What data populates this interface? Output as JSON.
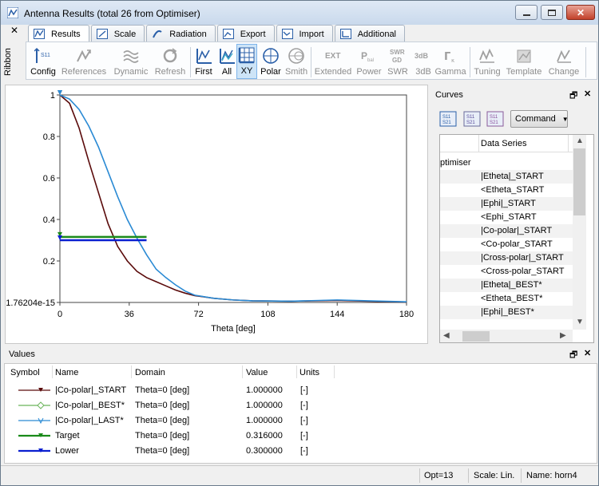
{
  "window": {
    "title": "Antenna Results (total 26 from Optimiser)"
  },
  "ribbon": {
    "side_label": "Ribbon",
    "tabs": [
      {
        "label": "Results",
        "icon": "results-tab-icon"
      },
      {
        "label": "Scale",
        "icon": "scale-tab-icon"
      },
      {
        "label": "Radiation",
        "icon": "radiation-tab-icon"
      },
      {
        "label": "Export",
        "icon": "export-tab-icon"
      },
      {
        "label": "Import",
        "icon": "import-tab-icon"
      },
      {
        "label": "Additional",
        "icon": "additional-tab-icon"
      }
    ],
    "buttons": [
      {
        "label": "Config",
        "icon_text": "S11",
        "enabled": true
      },
      {
        "label": "References",
        "enabled": false
      },
      {
        "label": "Dynamic",
        "enabled": false
      },
      {
        "label": "Refresh",
        "enabled": false
      },
      {
        "label": "First",
        "enabled": true
      },
      {
        "label": "All",
        "enabled": true
      },
      {
        "label": "XY",
        "enabled": true,
        "selected": true
      },
      {
        "label": "Polar",
        "enabled": true
      },
      {
        "label": "Smith",
        "enabled": false
      },
      {
        "label": "Extended",
        "icon_text": "EXT",
        "enabled": false
      },
      {
        "label": "Power",
        "icon_text": "Pbal",
        "enabled": false
      },
      {
        "label": "SWR",
        "icon_text": "SWR GD",
        "enabled": false
      },
      {
        "label": "3dB",
        "icon_text": "3dB",
        "enabled": false
      },
      {
        "label": "Gamma",
        "icon_text": "Γκ",
        "enabled": false
      },
      {
        "label": "Tuning",
        "enabled": false
      },
      {
        "label": "Template",
        "enabled": false
      },
      {
        "label": "Change",
        "enabled": false
      }
    ]
  },
  "chart_data": {
    "type": "line",
    "xlabel": "Theta [deg]",
    "ylabel": "",
    "xlim": [
      0,
      180
    ],
    "ylim": [
      0,
      1
    ],
    "x_ticks": [
      "0",
      "36",
      "72",
      "108",
      "144",
      "180"
    ],
    "y_ticks": [
      "1.76204e-15",
      "0.2",
      "0.4",
      "0.6",
      "0.8",
      "1"
    ],
    "grid": false,
    "series": [
      {
        "name": "|Co-polar|_START",
        "color": "#5a0a0a",
        "x": [
          0,
          5,
          10,
          15,
          20,
          25,
          30,
          35,
          40,
          45,
          50,
          55,
          60,
          65,
          70,
          80,
          90,
          100,
          120,
          144,
          160,
          180
        ],
        "y": [
          1.0,
          0.96,
          0.84,
          0.68,
          0.53,
          0.38,
          0.27,
          0.2,
          0.15,
          0.12,
          0.1,
          0.08,
          0.06,
          0.045,
          0.033,
          0.02,
          0.012,
          0.008,
          0.006,
          0.01,
          0.006,
          0.002
        ]
      },
      {
        "name": "|Co-polar|_LAST*",
        "color": "#2a8ad4",
        "x": [
          0,
          5,
          10,
          15,
          20,
          25,
          30,
          35,
          40,
          45,
          50,
          55,
          60,
          65,
          70,
          80,
          90,
          100,
          120,
          144,
          160,
          180
        ],
        "y": [
          1.0,
          0.98,
          0.93,
          0.85,
          0.75,
          0.63,
          0.51,
          0.4,
          0.31,
          0.23,
          0.16,
          0.12,
          0.085,
          0.055,
          0.035,
          0.02,
          0.012,
          0.008,
          0.006,
          0.012,
          0.008,
          0.003
        ]
      },
      {
        "name": "Target",
        "color": "#1a8a1a",
        "x": [
          0,
          45
        ],
        "y": [
          0.316,
          0.316
        ]
      },
      {
        "name": "Lower",
        "color": "#0a1fd0",
        "x": [
          0,
          45
        ],
        "y": [
          0.3,
          0.3
        ]
      }
    ]
  },
  "curves_panel": {
    "title": "Curves",
    "command_label": "Command",
    "icons": [
      "S11 S21",
      "S11 S21",
      "S11 S21"
    ],
    "column_header": "Data Series",
    "group_label": "ptimiser",
    "rows": [
      "|Etheta|_START",
      "<Etheta_START",
      "|Ephi|_START",
      "<Ephi_START",
      "|Co-polar|_START",
      "<Co-polar_START",
      "|Cross-polar|_START",
      "<Cross-polar_START",
      "|Etheta|_BEST*",
      "<Etheta_BEST*",
      "|Ephi|_BEST*"
    ]
  },
  "values_panel": {
    "title": "Values",
    "headers": {
      "symbol": "Symbol",
      "name": "Name",
      "domain": "Domain",
      "value": "Value",
      "units": "Units"
    },
    "rows": [
      {
        "name": "|Co-polar|_START",
        "domain": "Theta=0 [deg]",
        "value": "1.000000",
        "units": "[-]",
        "color": "#5a0a0a"
      },
      {
        "name": "|Co-polar|_BEST*",
        "domain": "Theta=0 [deg]",
        "value": "1.000000",
        "units": "[-]",
        "color": "#6ab45a"
      },
      {
        "name": "|Co-polar|_LAST*",
        "domain": "Theta=0 [deg]",
        "value": "1.000000",
        "units": "[-]",
        "color": "#2a8ad4"
      },
      {
        "name": "Target",
        "domain": "Theta=0 [deg]",
        "value": "0.316000",
        "units": "[-]",
        "color": "#1a8a1a"
      },
      {
        "name": "Lower",
        "domain": "Theta=0 [deg]",
        "value": "0.300000",
        "units": "[-]",
        "color": "#0a1fd0"
      }
    ]
  },
  "status_bar": {
    "opt": "Opt=13",
    "scale": "Scale: Lin.",
    "name": "Name: horn4"
  }
}
